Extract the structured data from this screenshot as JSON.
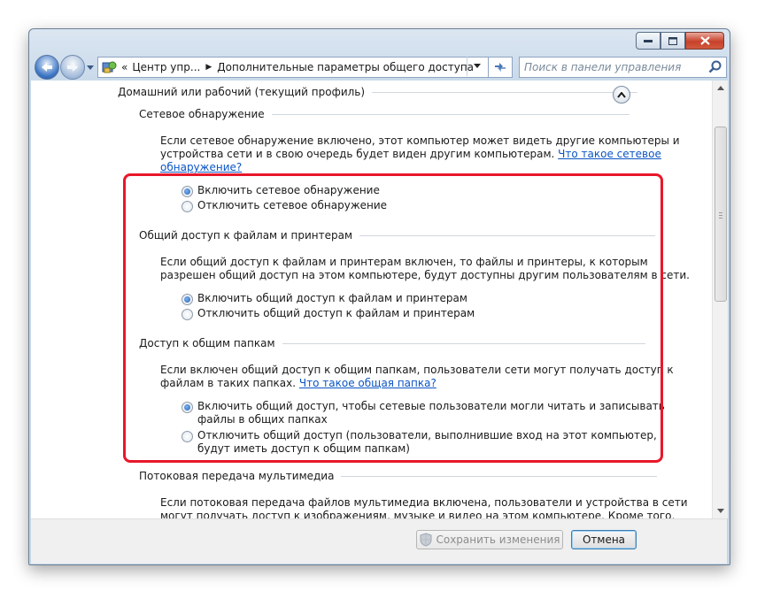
{
  "window": {
    "caption_buttons": [
      "minimize-icon",
      "maximize-icon",
      "close-icon"
    ]
  },
  "address_bar": {
    "overflow_marker": "«",
    "crumbs": [
      "Центр упр...",
      "Дополнительные параметры общего доступа"
    ],
    "search_placeholder": "Поиск в панели управления"
  },
  "profile": {
    "title": "Домашний или рабочий (текущий профиль)"
  },
  "sections": {
    "discovery": {
      "title": "Сетевое обнаружение",
      "desc1": "Если сетевое обнаружение включено, этот компьютер может видеть другие компьютеры и",
      "desc2": "устройства сети и в свою очередь будет виден другим компьютерам.",
      "link_part1": "Что такое сетевое",
      "link_part2": "обнаружение?",
      "opt_on": "Включить сетевое обнаружение",
      "opt_off": "Отключить сетевое обнаружение"
    },
    "file_sharing": {
      "title": "Общий доступ к файлам и принтерам",
      "desc1": "Если общий доступ к файлам и принтерам включен, то файлы и принтеры, к которым",
      "desc2": "разрешен общий доступ на этом компьютере, будут доступны другим пользователям в сети.",
      "opt_on": "Включить общий доступ к файлам и принтерам",
      "opt_off": "Отключить общий доступ к файлам и принтерам"
    },
    "public_folders": {
      "title": "Доступ к общим папкам",
      "desc1": "Если включен общий доступ к общим папкам, пользователи сети могут получать доступ к",
      "desc2": "файлам в таких папках.",
      "link": "Что такое общая папка?",
      "opt_on_1": "Включить общий доступ, чтобы сетевые пользователи могли читать и записывать",
      "opt_on_2": "файлы в общих папках",
      "opt_off_1": "Отключить общий доступ (пользователи, выполнившие вход на этот компьютер,",
      "opt_off_2": "будут иметь доступ к общим папкам)"
    },
    "media": {
      "title": "Потоковая передача мультимедиа",
      "desc1": "Если потоковая передача файлов мультимедиа включена, пользователи и устройства в сети",
      "desc2": "могут получать доступ к изображениям, музыке и видео на этом компьютере. Кроме того,"
    }
  },
  "footer": {
    "save_label": "Сохранить изменения",
    "cancel_label": "Отмена"
  },
  "colors": {
    "highlight": "#e8172a",
    "link": "#0b55c4"
  }
}
